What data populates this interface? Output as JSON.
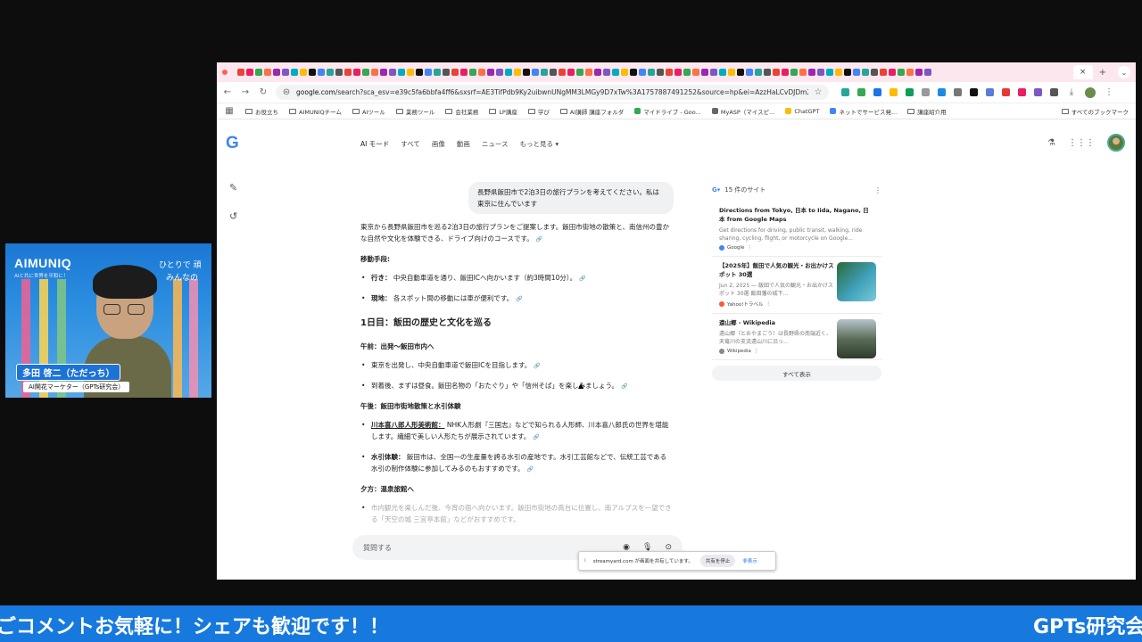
{
  "browser": {
    "omnibox_url_host": "google.com",
    "omnibox_url_rest": "/search?sca_esv=e39c5fa6bbfa4ff6&sxsrf=AE3TifPdb9Ky2uibwnUNgMM3LMGy9D7xTw%3A1757887491252&source=hp&ei=AzzHaLCvDJDm2roP3I...",
    "bookmarks": [
      "お役立ち",
      "AIMUNIQチーム",
      "AIツール",
      "業務ツール",
      "会社業務",
      "LP講座",
      "学び",
      "AI講師 講座フォルダ",
      "マイドライブ - Goo...",
      "MyASP（マイスピ...",
      "ChatGPT",
      "ネットでサービス発...",
      "講座紹介用"
    ],
    "bookmarks_all": "すべてのブックマーク",
    "tab_close": "×",
    "tab_new": "+"
  },
  "google": {
    "logo": "G",
    "tabs": [
      "AI モード",
      "すべて",
      "画像",
      "動画",
      "ニュース",
      "もっと見る ▾"
    ],
    "user_query": "長野県飯田市で2泊3日の旅行プランを考えてください。私は東京に住んでいます",
    "intro": "東京から長野県飯田市を巡る2泊3日の旅行プランをご提案します。飯田市街地の散策と、南信州の豊かな自然や文化を体験できる、ドライブ向けのコースです。",
    "transport_heading": "移動手段:",
    "transport": [
      {
        "label": "行き：",
        "text": "中央自動車道を通り、飯田ICへ向かいます（約3時間10分）。"
      },
      {
        "label": "現地：",
        "text": "各スポット間の移動には車が便利です。"
      }
    ],
    "day1_heading": "1日目：飯田の歴史と文化を巡る",
    "am_heading": "午前：出発〜飯田市内へ",
    "am_items": [
      "東京を出発し、中央自動車道で飯田ICを目指します。",
      "到着後、まずは昼食。飯田名物の「おたぐり」や「信州そば」を楽しみましょう。"
    ],
    "pm_heading": "午後：飯田市街地散策と水引体験",
    "pm_items": [
      {
        "label": "川本喜八郎人形美術館：",
        "text": "NHK人形劇『三国志』などで知られる人形師、川本喜八郎氏の世界を堪能します。繊細で美しい人形たちが展示されています。"
      },
      {
        "label": "水引体験：",
        "text": "飯田市は、全国一の生産量を誇る水引の産地です。水引工芸館などで、伝統工芸である水引の制作体験に参加してみるのもおすすめです。"
      }
    ],
    "evening_heading": "夕方：温泉旅館へ",
    "evening_item": "市内観光を楽しんだ後、今宵の宿へ向かいます。飯田市街地の高台に位置し、南アルプスを一望できる「天空の城 三宜亭本館」などがおすすめです。",
    "ask_placeholder": "質問する",
    "sources_count": "15 件のサイト",
    "sources": [
      {
        "title": "Directions from Tokyo, 日本 to Iida, Nagano, 日本 from Google Maps",
        "desc": "Get directions for driving, public transit, walking, ride sharing, cycling, flight, or motorcycle on Google...",
        "site": "Google"
      },
      {
        "title": "【2025年】飯田で人気の観光・お出かけスポット 30選",
        "desc": "Jun 2, 2025 — 飯田で人気の観光・お出かけスポット 30選 飯田藩の城下...",
        "site": "Yahoo!トラベル"
      },
      {
        "title": "遠山郷 - Wikipedia",
        "desc": "遠山郷（とおやまごう）は長野県の南端近く、天竜川の支流遠山川に沿っ...",
        "site": "Wikipedia"
      }
    ],
    "show_all": "すべて表示"
  },
  "share_bar": {
    "text": "streamyard.com が画面を共有しています。",
    "stop": "共有を停止",
    "hide": "非表示"
  },
  "webcam": {
    "logo": "AIMUNIQ",
    "tagline": "AIと共に世界を平和に！",
    "right_line1": "ひとりで 頑",
    "right_line2": "みんなの",
    "name": "多田 啓二（ただっち）",
    "role": "AI開花マーケター（GPTs研究会）"
  },
  "ticker": {
    "message": "ごコメントお気軽に！シェアも歓迎です！！",
    "brand": "GPTs研究会"
  },
  "colors": {
    "ticker_bg": "#1779de",
    "tabbar_bg": "#fde7ef",
    "google_blue": "#4285f4"
  }
}
